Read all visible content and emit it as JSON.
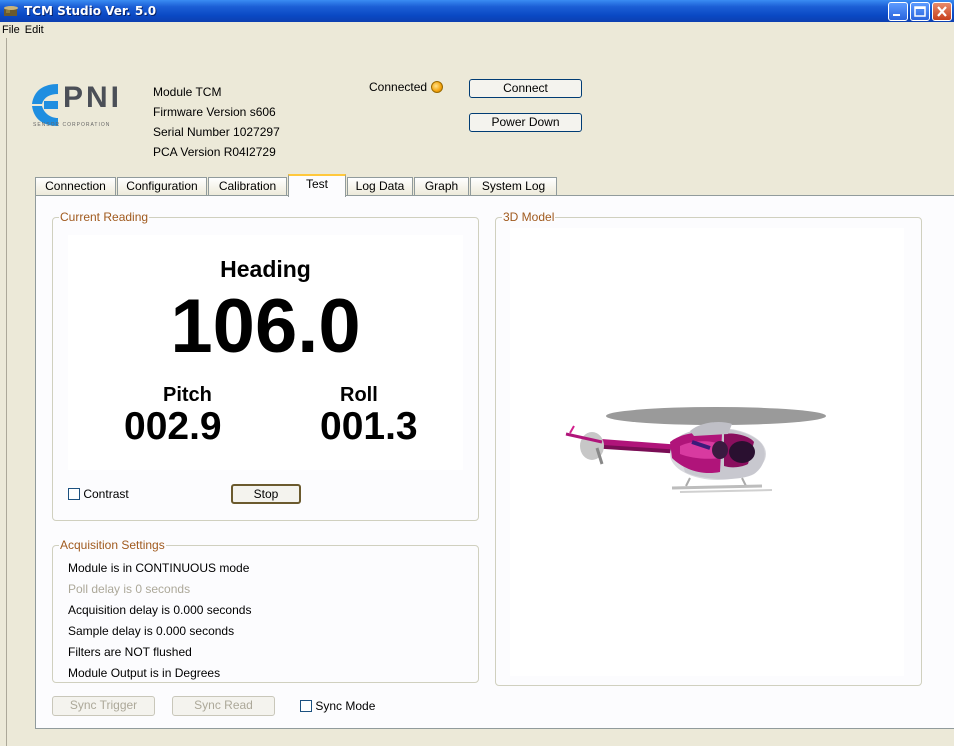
{
  "window": {
    "title": "TCM Studio Ver. 5.0"
  },
  "menu": [
    "File",
    "Edit"
  ],
  "device": {
    "module": "Module TCM",
    "firmware": "Firmware Version s606",
    "serial": "Serial Number 1027297",
    "pca": "PCA Version R04I2729"
  },
  "logo": {
    "brand": "PNI",
    "tagline": "SENSOR CORPORATION"
  },
  "connection": {
    "status_label": "Connected",
    "connect_button": "Connect",
    "power_down_button": "Power Down",
    "led_color": "#f4a20b"
  },
  "tabs": [
    "Connection",
    "Configuration",
    "Calibration",
    "Test",
    "Log Data",
    "Graph",
    "System Log"
  ],
  "active_tab": "Test",
  "current_reading": {
    "group_label": "Current Reading",
    "heading_label": "Heading",
    "heading_value": "106.0",
    "pitch_label": "Pitch",
    "pitch_value": "002.9",
    "roll_label": "Roll",
    "roll_value": "001.3",
    "contrast_label": "Contrast",
    "contrast_checked": false,
    "stop_button": "Stop"
  },
  "acquisition": {
    "group_label": "Acquisition Settings",
    "lines": [
      "Module is in CONTINUOUS mode",
      "Poll delay is 0 seconds",
      "Acquisition delay is 0.000 seconds",
      "Sample delay is 0.000 seconds",
      "Filters are NOT flushed",
      "Module Output is in Degrees"
    ]
  },
  "sync": {
    "trigger_button": "Sync Trigger",
    "read_button": "Sync Read",
    "mode_label": "Sync Mode",
    "mode_checked": false
  },
  "model": {
    "group_label": "3D Model"
  },
  "colors": {
    "accent_orange": "#a05a1e",
    "title_blue": "#0a49c4",
    "helicopter_magenta": "#b0147a"
  }
}
